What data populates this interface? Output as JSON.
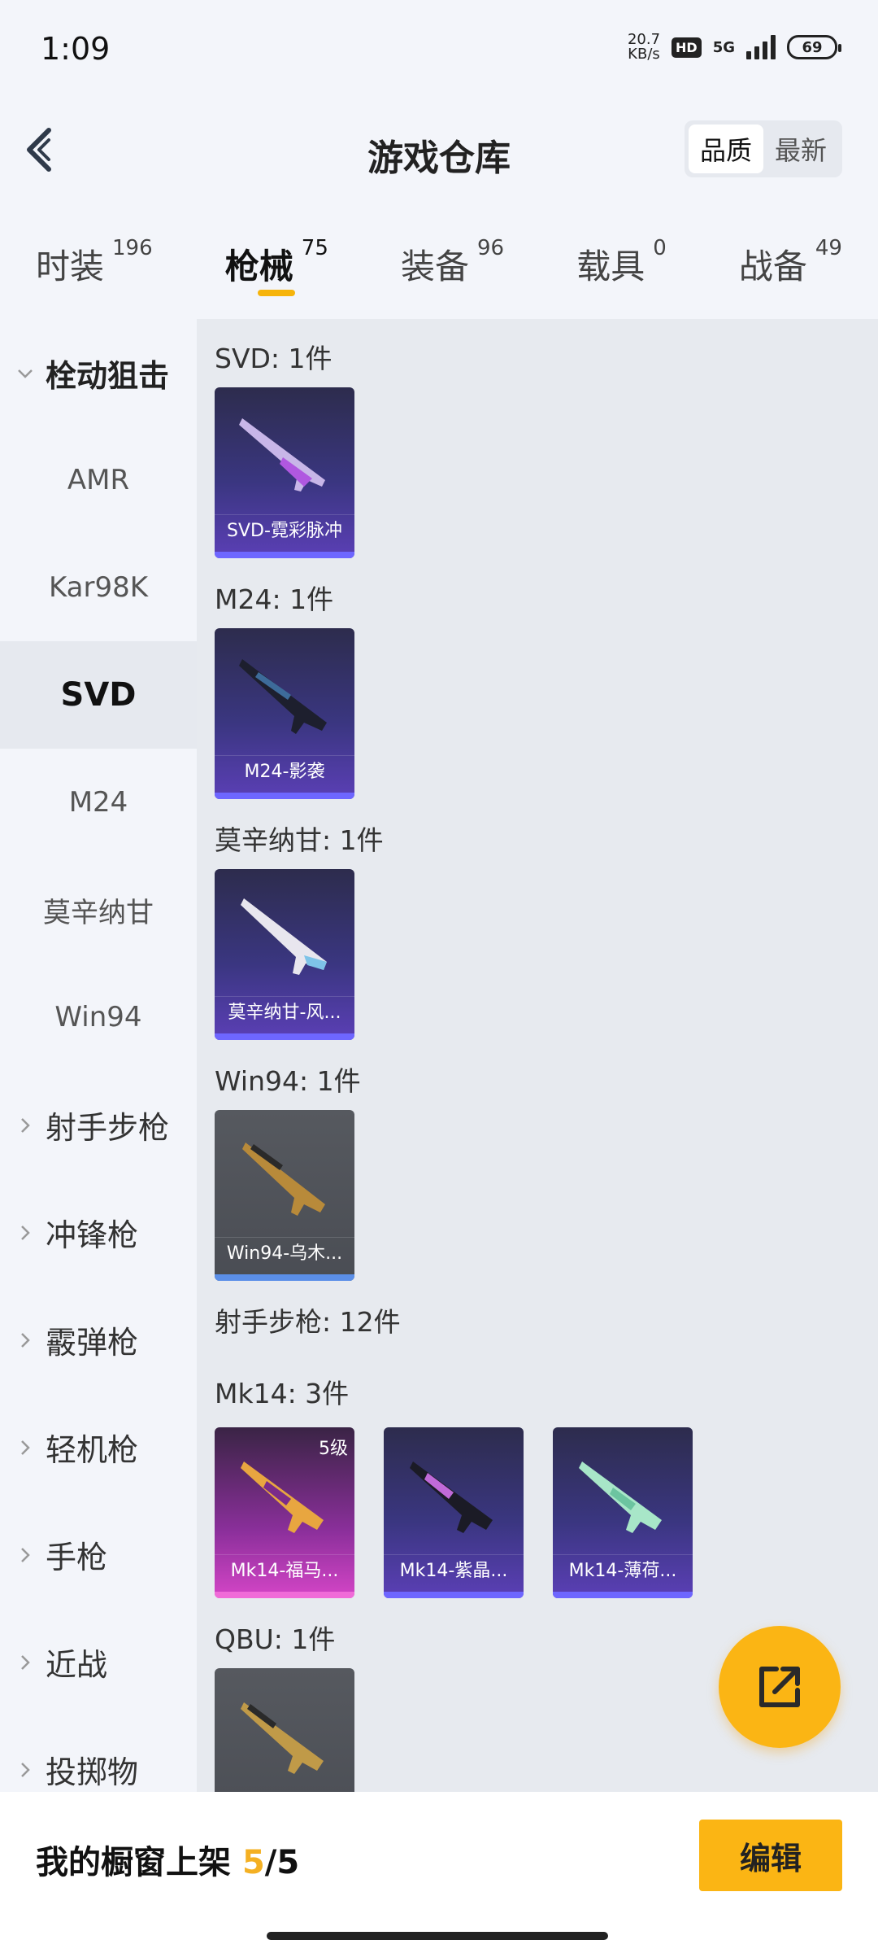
{
  "status_bar": {
    "time": "1:09",
    "net_speed_value": "20.7",
    "net_speed_unit": "KB/s",
    "hd": "HD",
    "network": "5G",
    "battery": "69"
  },
  "header": {
    "title": "游戏仓库",
    "sort_options": [
      "品质",
      "最新"
    ],
    "sort_active": "品质"
  },
  "tabs": [
    {
      "label": "时装",
      "count": "196"
    },
    {
      "label": "枪械",
      "count": "75",
      "active": true
    },
    {
      "label": "装备",
      "count": "96"
    },
    {
      "label": "载具",
      "count": "0"
    },
    {
      "label": "战备",
      "count": "49"
    }
  ],
  "sidebar": {
    "groups": [
      {
        "label": "栓动狙击",
        "open": true,
        "items": [
          "AMR",
          "Kar98K",
          "SVD",
          "M24",
          "莫辛纳甘",
          "Win94"
        ],
        "active_item": "SVD"
      },
      {
        "label": "射手步枪"
      },
      {
        "label": "冲锋枪"
      },
      {
        "label": "霰弹枪"
      },
      {
        "label": "轻机枪"
      },
      {
        "label": "手枪"
      },
      {
        "label": "近战"
      },
      {
        "label": "投掷物"
      }
    ]
  },
  "content": {
    "sections": [
      {
        "label": "SVD: 1件",
        "items": [
          {
            "name": "SVD-霓彩脉冲",
            "rarity": "purple"
          }
        ]
      },
      {
        "label": "M24: 1件",
        "items": [
          {
            "name": "M24-影袭",
            "rarity": "purple"
          }
        ]
      },
      {
        "label": "莫辛纳甘: 1件",
        "items": [
          {
            "name": "莫辛纳甘-风...",
            "rarity": "purple"
          }
        ]
      },
      {
        "label": "Win94: 1件",
        "items": [
          {
            "name": "Win94-乌木...",
            "rarity": "gray"
          }
        ]
      },
      {
        "label": "射手步枪: 12件"
      },
      {
        "label": "Mk14: 3件",
        "items": [
          {
            "name": "Mk14-福马...",
            "rarity": "pink",
            "grade": "5级"
          },
          {
            "name": "Mk14-紫晶...",
            "rarity": "purple"
          },
          {
            "name": "Mk14-薄荷...",
            "rarity": "purple"
          }
        ]
      },
      {
        "label": "QBU: 1件",
        "items": [
          {
            "name": "",
            "rarity": "gray"
          }
        ]
      }
    ]
  },
  "bottom_bar": {
    "shelf_label": "我的橱窗上架",
    "shelf_current": "5",
    "shelf_total": "/5",
    "edit_label": "编辑"
  },
  "colors": {
    "accent": "#fbb514",
    "purple_card": "#3a3680",
    "gray_card": "#4a4d54",
    "pink_card": "#d545c7"
  }
}
